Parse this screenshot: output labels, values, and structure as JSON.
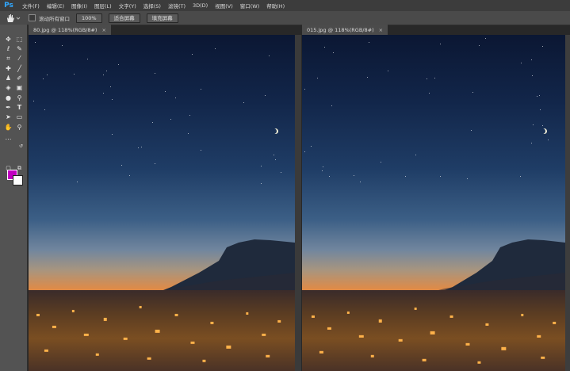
{
  "app": {
    "logo": "Ps"
  },
  "menu": [
    "文件(F)",
    "编辑(E)",
    "图像(I)",
    "图层(L)",
    "文字(Y)",
    "选择(S)",
    "滤镜(T)",
    "3D(D)",
    "视图(V)",
    "窗口(W)",
    "帮助(H)"
  ],
  "options": {
    "scroll_all_label": "滚动所有窗口",
    "zoom_value": "100%",
    "fit_screen": "适合屏幕",
    "fill_screen": "填充屏幕"
  },
  "tabs": [
    {
      "title": "80.jpg @ 118%(RGB/8#)",
      "close": "×"
    },
    {
      "title": "015.jpg @ 118%(RGB/8#)",
      "close": "×"
    }
  ],
  "tools": [
    "move-icon",
    "marquee-icon",
    "lasso-icon",
    "quick-select-icon",
    "crop-icon",
    "eyedropper-icon",
    "healing-icon",
    "brush-icon",
    "stamp-icon",
    "history-brush-icon",
    "eraser-icon",
    "gradient-icon",
    "blur-icon",
    "dodge-icon",
    "pen-icon",
    "type-icon",
    "path-select-icon",
    "rectangle-icon",
    "hand-icon",
    "zoom-icon"
  ],
  "colors": {
    "foreground": "#c000c0",
    "background": "#ffffff"
  }
}
